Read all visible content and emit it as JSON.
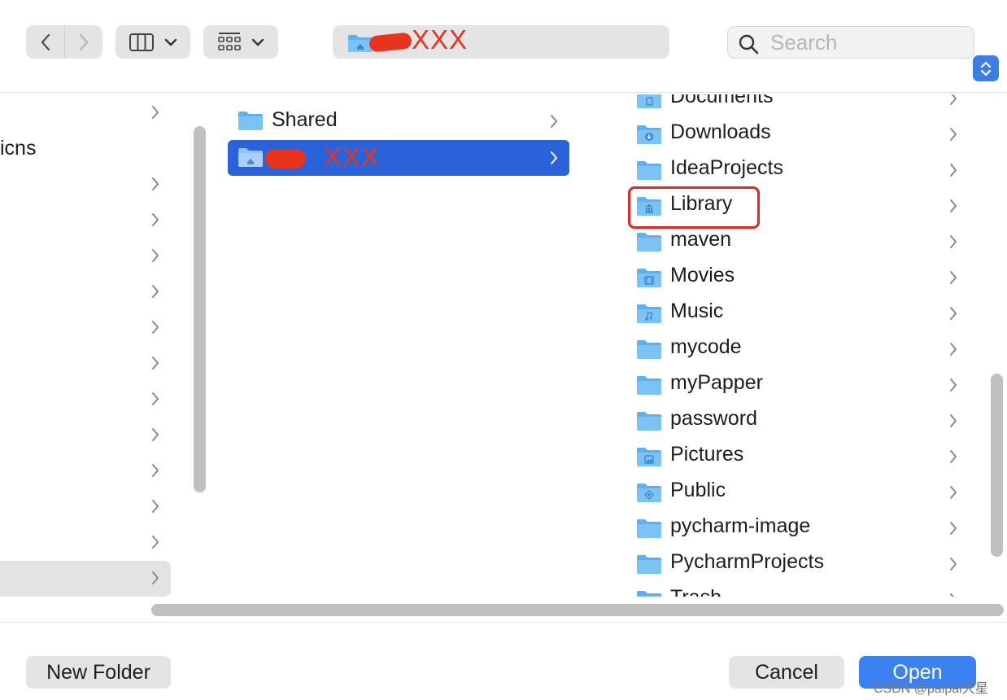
{
  "toolbar": {
    "location_name": "XXX",
    "search_placeholder": "Search"
  },
  "column1": {
    "visible_label": "icns"
  },
  "column2": {
    "items": [
      {
        "label": "Shared"
      },
      {
        "label": "XXX"
      }
    ]
  },
  "column3": {
    "items": [
      {
        "label": "Documents",
        "icon": "documents-folder-icon"
      },
      {
        "label": "Downloads",
        "icon": "downloads-folder-icon"
      },
      {
        "label": "IdeaProjects",
        "icon": "folder-icon"
      },
      {
        "label": "Library",
        "icon": "library-folder-icon"
      },
      {
        "label": "maven",
        "icon": "folder-icon"
      },
      {
        "label": "Movies",
        "icon": "movies-folder-icon"
      },
      {
        "label": "Music",
        "icon": "music-folder-icon"
      },
      {
        "label": "mycode",
        "icon": "folder-icon"
      },
      {
        "label": "myPapper",
        "icon": "folder-icon"
      },
      {
        "label": "password",
        "icon": "folder-icon"
      },
      {
        "label": "Pictures",
        "icon": "pictures-folder-icon"
      },
      {
        "label": "Public",
        "icon": "public-folder-icon"
      },
      {
        "label": "pycharm-image",
        "icon": "folder-icon"
      },
      {
        "label": "PycharmProjects",
        "icon": "folder-icon"
      },
      {
        "label": "Trash",
        "icon": "folder-icon"
      }
    ]
  },
  "buttons": {
    "new_folder": "New Folder",
    "cancel": "Cancel",
    "open": "Open"
  },
  "watermark": "CSDN @paipai大星",
  "colors": {
    "selection": "#2962d9",
    "accent": "#3b82f0",
    "annotation": "#e02820",
    "folder": "#5fb0ee"
  }
}
